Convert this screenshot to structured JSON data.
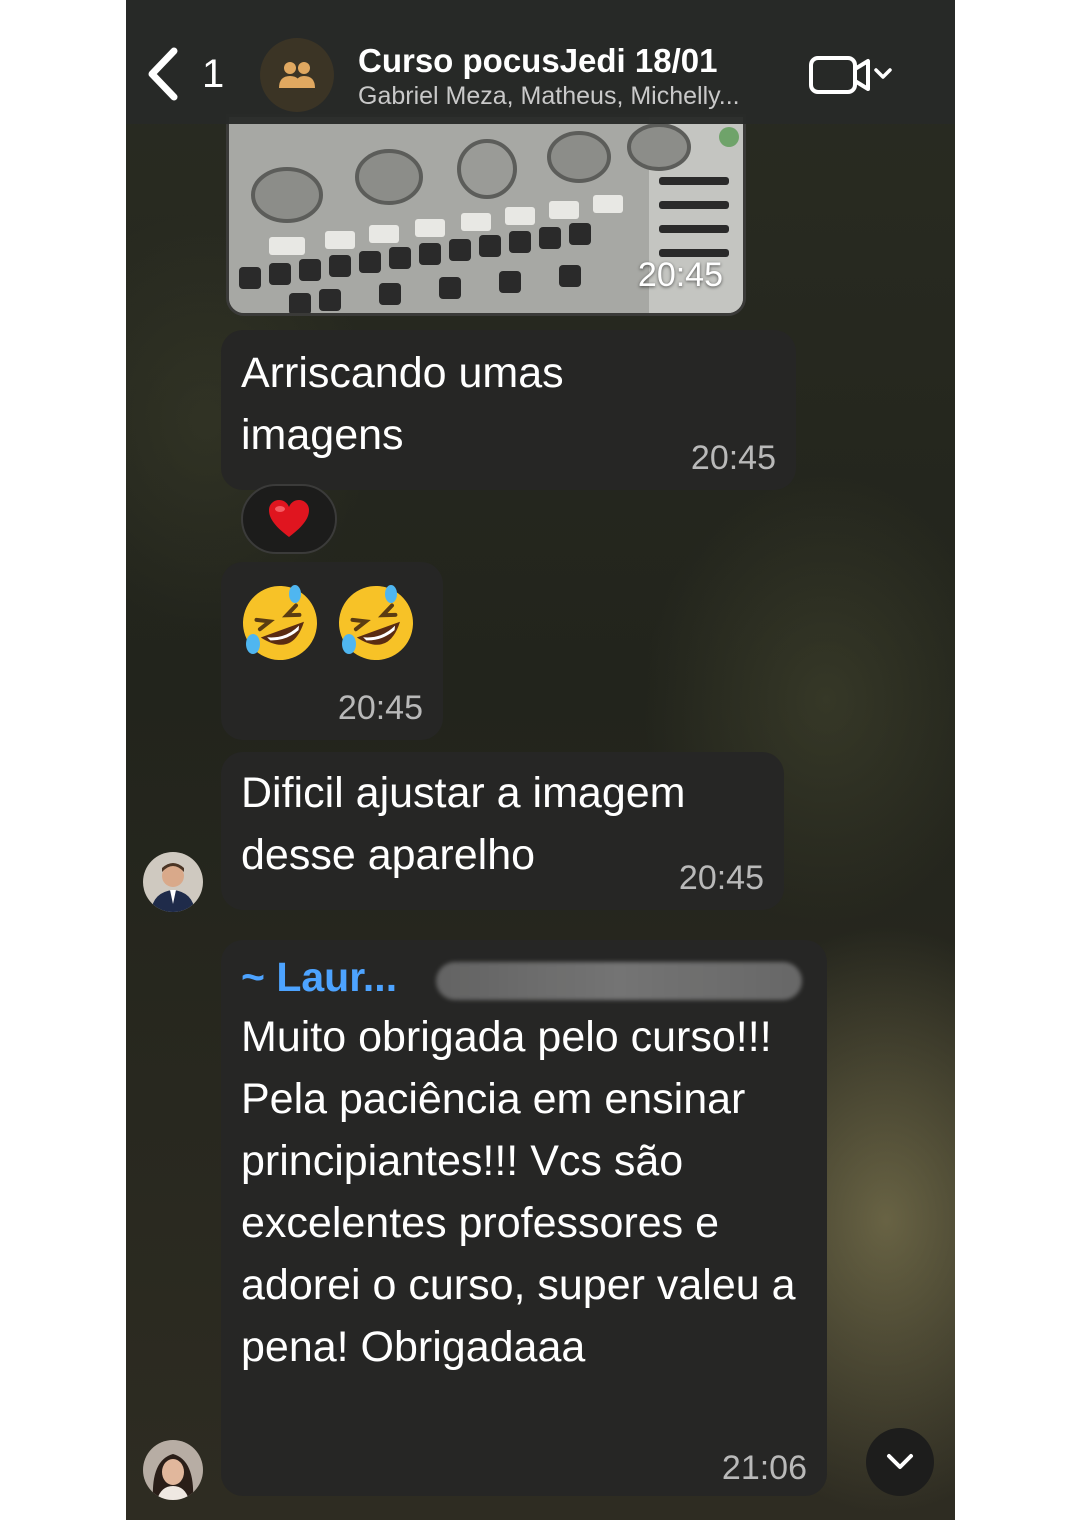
{
  "header": {
    "back_count": "1",
    "title": "Curso pocusJedi 18/01",
    "subtitle": "Gabriel Meza, Matheus, Michelly..."
  },
  "messages": {
    "image_time": "20:45",
    "m1_text": "Arriscando umas imagens",
    "m1_time": "20:45",
    "reaction": "❤️",
    "m2_time": "20:45",
    "m3_text": "Dificil ajustar a imagem desse aparelho",
    "m3_time": "20:45",
    "m4_sender": "~ Laur...",
    "m4_text": "Muito obrigada pelo curso!!! Pela paciência em ensinar principiantes!!! Vcs são excelentes professores e adorei o curso, super valeu a pena! Obrigadaaa",
    "m4_time": "21:06"
  },
  "icons": {
    "back": "chevron-left-icon",
    "group": "group-icon",
    "video": "video-call-icon",
    "scroll": "chevron-down-icon"
  },
  "colors": {
    "sender_name": "#4da3ff",
    "bubble": "#262625",
    "header": "#282a28"
  }
}
